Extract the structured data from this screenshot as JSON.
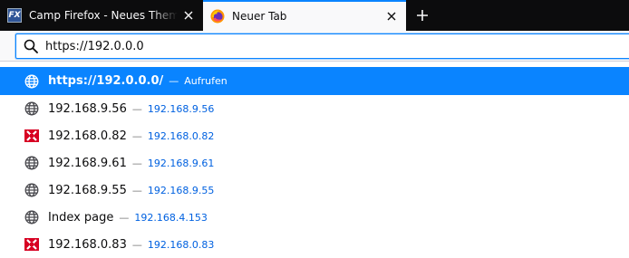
{
  "tabs": [
    {
      "title": "Camp Firefox - Neues Thema e",
      "favicon": "fx-logo-icon",
      "active": false
    },
    {
      "title": "Neuer Tab",
      "favicon": "firefox-icon",
      "active": true
    }
  ],
  "urlbar": {
    "value": "https://192.0.0.0"
  },
  "results": [
    {
      "title": "https://192.0.0.0/",
      "sep": "—",
      "url": "",
      "action": "Aufrufen",
      "icon": "globe-icon",
      "selected": true
    },
    {
      "title": "192.168.9.56",
      "sep": "—",
      "url": "192.168.9.56",
      "icon": "globe-icon"
    },
    {
      "title": "192.168.0.82",
      "sep": "—",
      "url": "192.168.0.82",
      "icon": "red-warning-icon"
    },
    {
      "title": "192.168.9.61",
      "sep": "—",
      "url": "192.168.9.61",
      "icon": "globe-icon"
    },
    {
      "title": "192.168.9.55",
      "sep": "—",
      "url": "192.168.9.55",
      "icon": "globe-icon"
    },
    {
      "title": "Index page",
      "sep": "—",
      "url": "192.168.4.153",
      "icon": "globe-icon"
    },
    {
      "title": "192.168.0.83",
      "sep": "—",
      "url": "192.168.0.83",
      "icon": "red-warning-icon"
    }
  ]
}
